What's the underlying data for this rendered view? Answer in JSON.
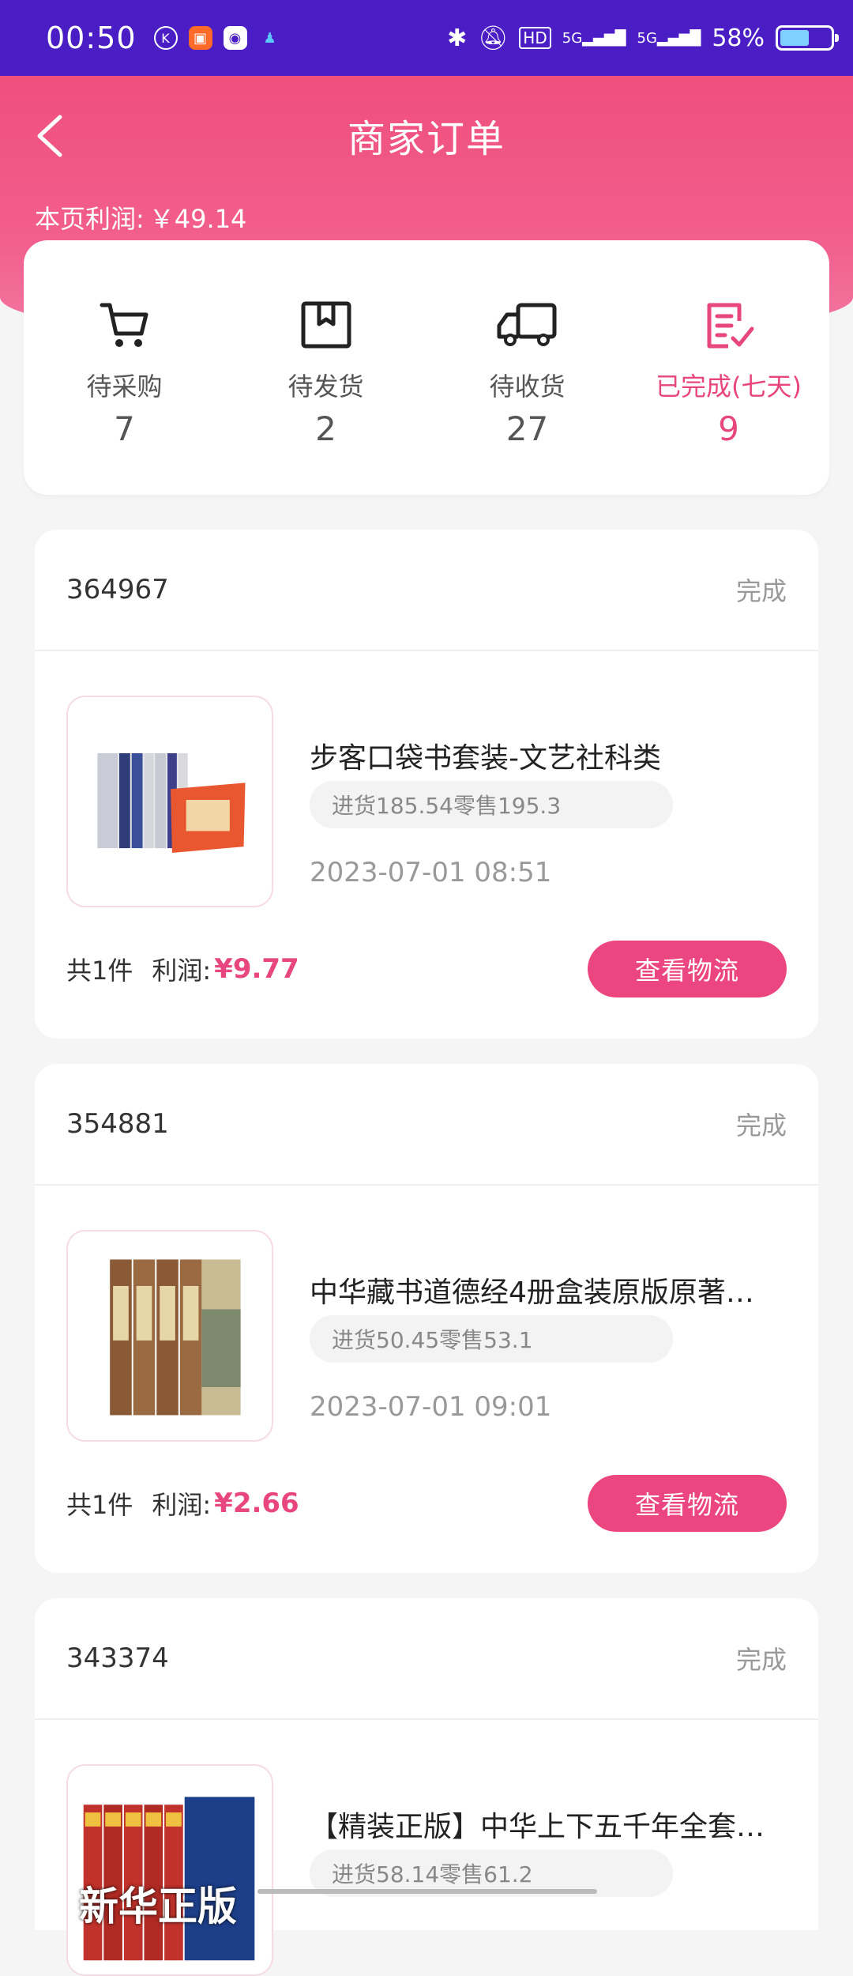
{
  "status_bar": {
    "time": "00:50",
    "network": "5G",
    "battery_percent": "58%",
    "battery_level": 0.58
  },
  "header": {
    "title": "商家订单",
    "page_profit_label": "本页利润:",
    "page_profit_value": "￥49.14"
  },
  "stats": [
    {
      "label": "待采购",
      "count": "7",
      "icon": "cart-icon"
    },
    {
      "label": "待发货",
      "count": "2",
      "icon": "box-icon"
    },
    {
      "label": "待收货",
      "count": "27",
      "icon": "truck-icon"
    },
    {
      "label": "已完成(七天)",
      "count": "9",
      "icon": "checklist-icon"
    }
  ],
  "orders": [
    {
      "id": "364967",
      "status": "完成",
      "product_name": "步客口袋书套装-文艺社科类",
      "price_info": "进货185.54零售195.3",
      "time": "2023-07-01 08:51",
      "qty": "共1件",
      "profit_label": "利润:",
      "profit": "¥9.77",
      "action": "查看物流"
    },
    {
      "id": "354881",
      "status": "完成",
      "product_name": "中华藏书道德经4册盒装原版原著…",
      "price_info": "进货50.45零售53.1",
      "time": "2023-07-01 09:01",
      "qty": "共1件",
      "profit_label": "利润:",
      "profit": "¥2.66",
      "action": "查看物流"
    },
    {
      "id": "343374",
      "status": "完成",
      "product_name": "【精装正版】中华上下五千年全套…",
      "price_info": "进货58.14零售61.2",
      "thumb_text": "新华正版"
    }
  ],
  "colors": {
    "accent": "#ec4680",
    "status_bar": "#4a1ec4",
    "header_pink": "#ef4f7c"
  }
}
